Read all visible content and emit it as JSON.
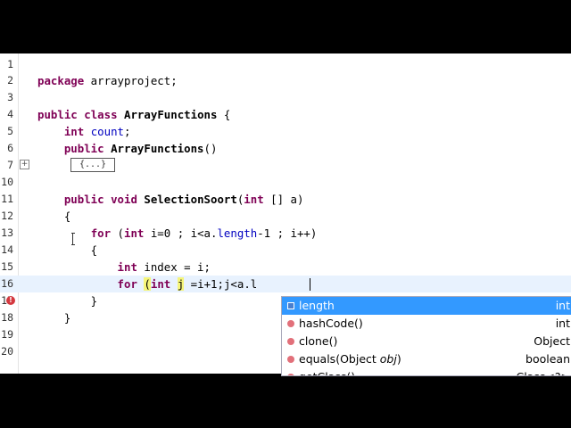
{
  "editor": {
    "lines": [
      {
        "num": "1",
        "code": ""
      },
      {
        "num": "2",
        "code": "package arrayproject;"
      },
      {
        "num": "3",
        "code": ""
      },
      {
        "num": "4",
        "code": "public class ArrayFunctions {"
      },
      {
        "num": "5",
        "code": "    int count;"
      },
      {
        "num": "6",
        "code": "    public ArrayFunctions()"
      },
      {
        "num": "7",
        "code": "{...}"
      },
      {
        "num": "10",
        "code": ""
      },
      {
        "num": "11",
        "code": "    public void SelectionSoort(int [] a)"
      },
      {
        "num": "12",
        "code": "    {"
      },
      {
        "num": "13",
        "code": "        for (int i=0 ; i<a.length-1 ; i++)"
      },
      {
        "num": "14",
        "code": "        {"
      },
      {
        "num": "15",
        "code": "            int index = i;"
      },
      {
        "num": "16",
        "code": "            for (int j =i+1;j<a.l"
      },
      {
        "num": "17",
        "code": "        }"
      },
      {
        "num": "18",
        "code": "    }"
      },
      {
        "num": "19",
        "code": ""
      },
      {
        "num": "20",
        "code": ""
      }
    ],
    "folded_block_label": "{...}"
  },
  "autocomplete": {
    "items": [
      {
        "icon": "field-icon",
        "name": "length",
        "type": "int",
        "selected": true
      },
      {
        "icon": "method-icon",
        "name": "hashCode()",
        "type": "int",
        "selected": false
      },
      {
        "icon": "method-icon",
        "name": "clone()",
        "type": "Object",
        "selected": false
      },
      {
        "icon": "method-icon",
        "name": "equals(Object obj)",
        "type": "boolean",
        "selected": false
      },
      {
        "icon": "method-icon",
        "name": "getClass()",
        "type": "Class<?>",
        "selected": false
      }
    ],
    "equals_param_type": "Object",
    "equals_param_name": "obj"
  },
  "colors": {
    "keyword": "#7f0055",
    "field": "#0000c0",
    "current_line": "#e8f2fe",
    "selection": "#3399ff",
    "occurrence_highlight": "#f5f57a",
    "error_marker": "#d4383f"
  }
}
